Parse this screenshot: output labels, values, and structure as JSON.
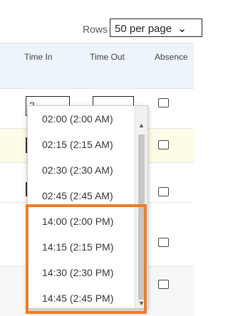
{
  "rows": {
    "label": "Rows",
    "selected": "50 per page",
    "chevron": "❯"
  },
  "columns": [
    "Time In",
    "Time Out",
    "Absence"
  ],
  "time_in": {
    "value": "2"
  },
  "dropdown": {
    "options": [
      "02:00 (2:00 AM)",
      "02:15 (2:15 AM)",
      "02:30 (2:30 AM)",
      "02:45 (2:45 AM)",
      "14:00 (2:00 PM)",
      "14:15 (2:15 PM)",
      "14:30 (2:30 PM)",
      "14:45 (2:45 PM)"
    ],
    "scroll_up": "▲",
    "scroll_down": "▼"
  },
  "colors": {
    "highlight": "#f37a24",
    "header_bg": "#eef4fb",
    "selected_row_bg": "#fdfce7"
  }
}
